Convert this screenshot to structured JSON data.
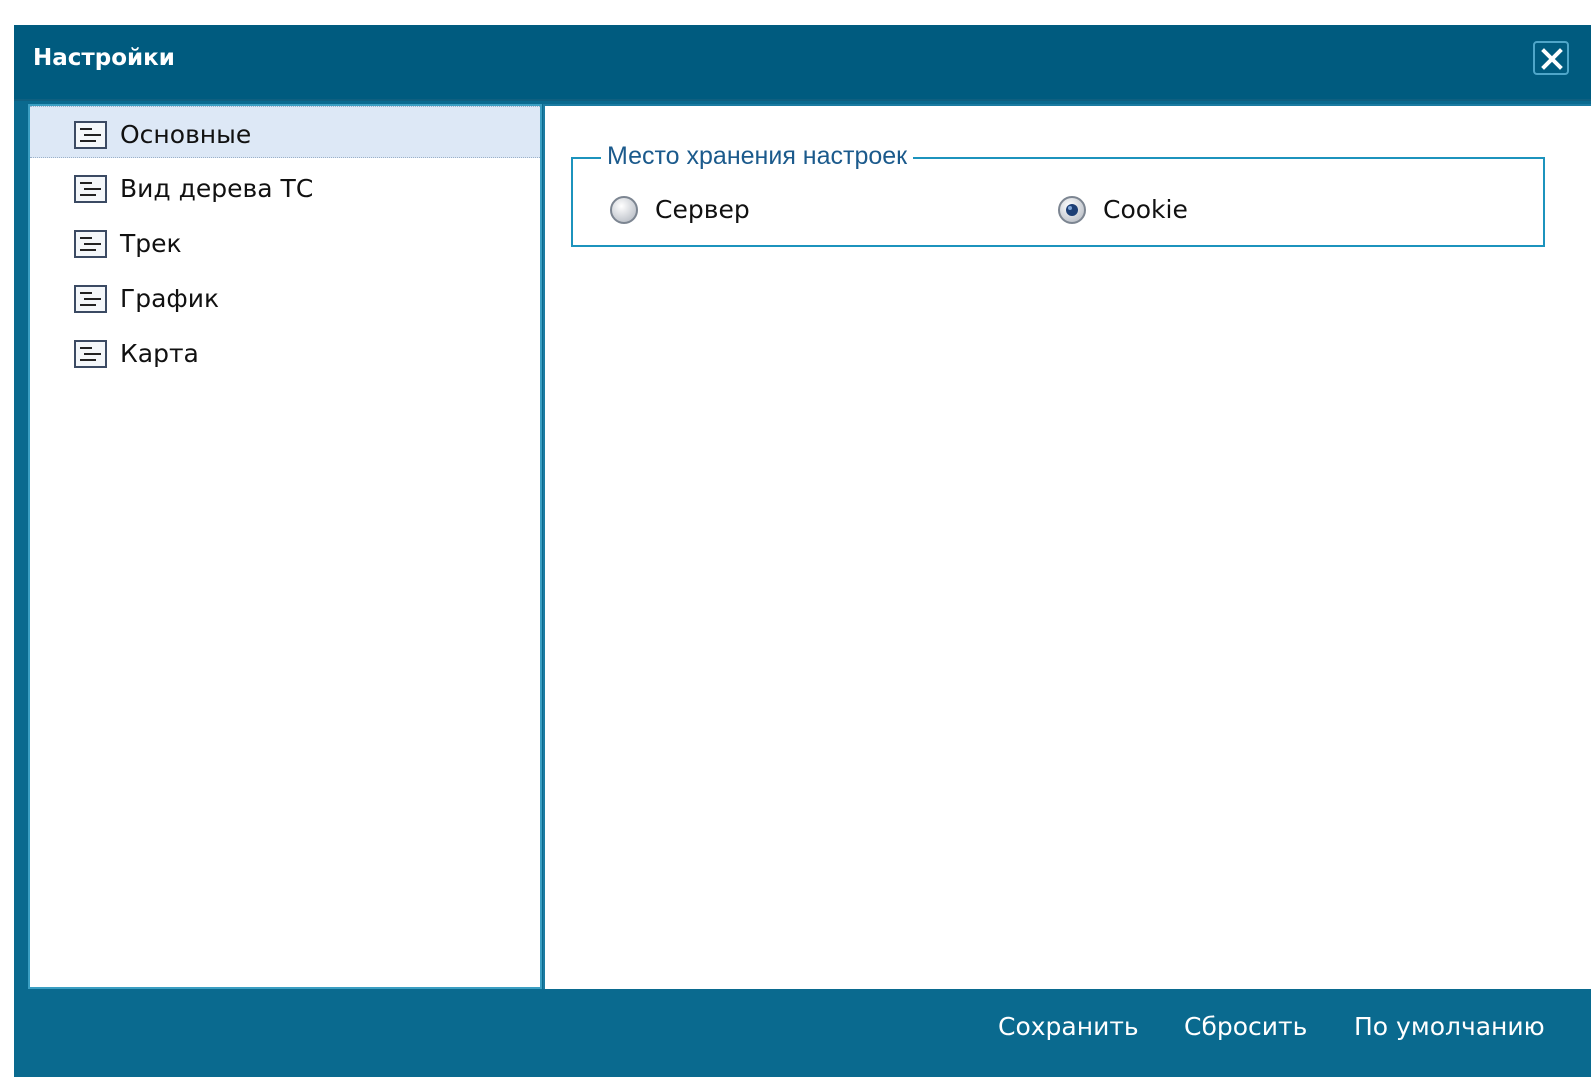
{
  "window": {
    "title": "Настройки"
  },
  "sidebar": {
    "items": [
      {
        "label": "Основные",
        "selected": true,
        "icon": "settings-list-icon"
      },
      {
        "label": "Вид дерева ТС",
        "selected": false,
        "icon": "settings-list-icon"
      },
      {
        "label": "Трек",
        "selected": false,
        "icon": "settings-list-icon"
      },
      {
        "label": "График",
        "selected": false,
        "icon": "settings-list-icon"
      },
      {
        "label": "Карта",
        "selected": false,
        "icon": "settings-list-icon"
      }
    ]
  },
  "storage": {
    "legend": "Место хранения настроек",
    "options": [
      {
        "label": "Сервер",
        "checked": false
      },
      {
        "label": "Cookie",
        "checked": true
      }
    ]
  },
  "footer": {
    "save_label": "Сохранить",
    "reset_label": "Сбросить",
    "default_label": "По умолчанию"
  },
  "colors": {
    "titlebar": "#005b7f",
    "frame": "#0a6a8f",
    "selected_row": "#dde8f6",
    "fieldset_border": "#1c93bd",
    "legend_text": "#1b5a8c"
  }
}
